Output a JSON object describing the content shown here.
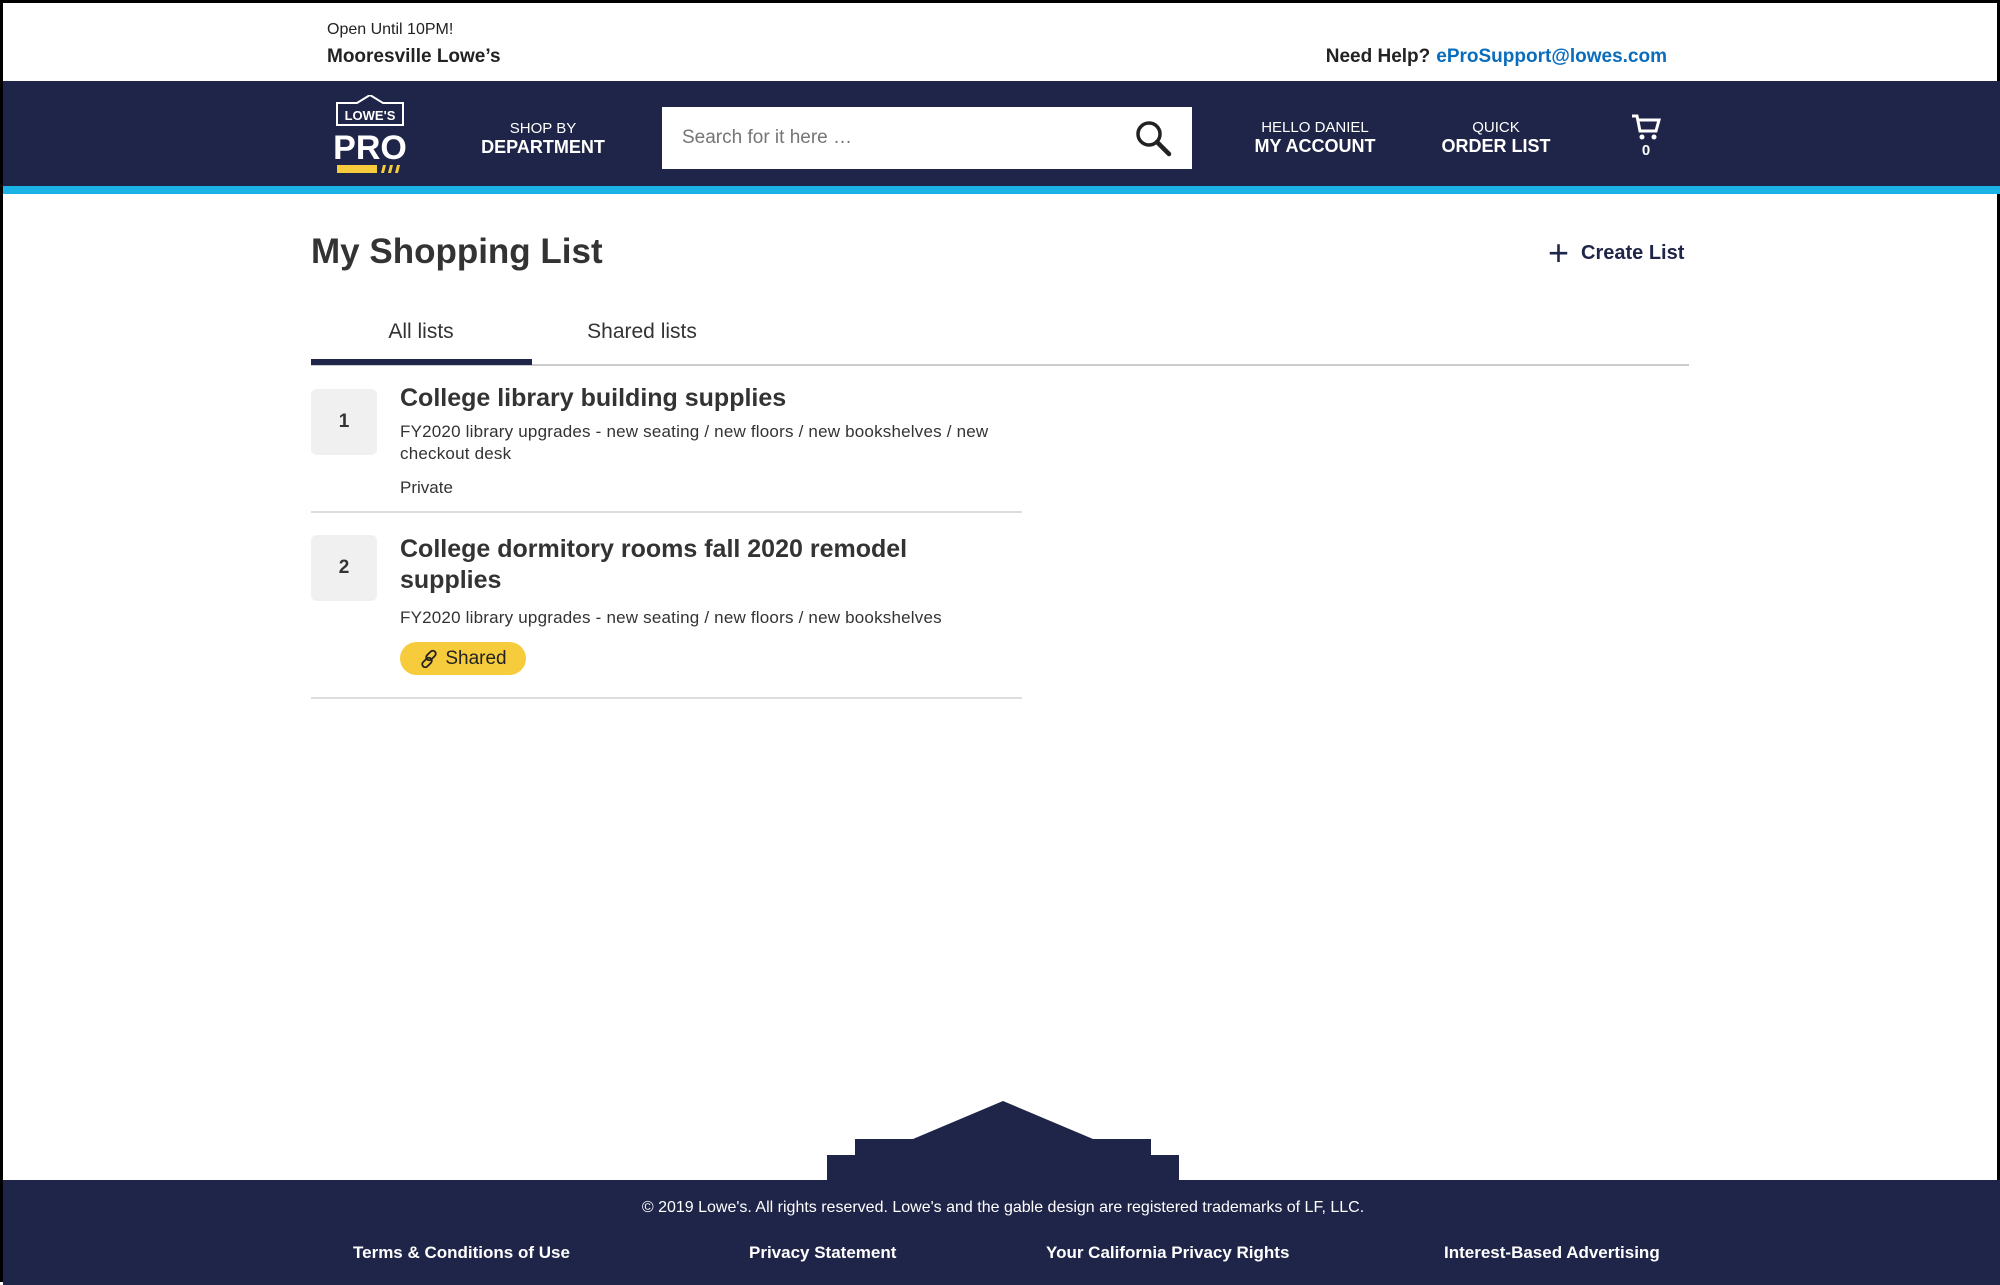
{
  "topbar": {
    "hours": "Open Until 10PM!",
    "store": "Mooresville Lowe’s",
    "help_label": "Need Help?",
    "help_email": "eProSupport@lowes.com"
  },
  "nav": {
    "logo_text": "LOWE'S PRO",
    "shop_by": "SHOP BY",
    "department": "DEPARTMENT",
    "search_placeholder": "Search for it here …",
    "hello": "HELLO DANIEL",
    "my_account": "MY ACCOUNT",
    "quick": "QUICK",
    "order_list": "ORDER LIST",
    "cart_count": "0"
  },
  "colors": {
    "navy": "#1f2548",
    "accent_blue": "#1bb3e6",
    "badge_yellow": "#f6cc3c",
    "link": "#0a6cbc"
  },
  "page": {
    "title": "My Shopping List",
    "create_list": "Create List",
    "tabs": [
      {
        "label": "All lists",
        "active": true
      },
      {
        "label": "Shared lists",
        "active": false
      }
    ]
  },
  "lists": [
    {
      "num": "1",
      "title": "College library building supplies",
      "desc": "FY2020 library upgrades - new seating / new floors / new bookshelves / new checkout desk",
      "status": "Private"
    },
    {
      "num": "2",
      "title": "College dormitory rooms fall 2020 remodel supplies",
      "desc": "FY2020 library upgrades - new seating / new floors / new bookshelves",
      "status": "Shared",
      "status_icon": "link-icon"
    }
  ],
  "footer": {
    "copyright": "© 2019 Lowe's. All rights reserved. Lowe's and the gable design are registered trademarks of LF, LLC.",
    "links": [
      "Terms & Conditions of Use",
      "Privacy Statement",
      "Your California Privacy Rights",
      "Interest-Based Advertising"
    ]
  }
}
